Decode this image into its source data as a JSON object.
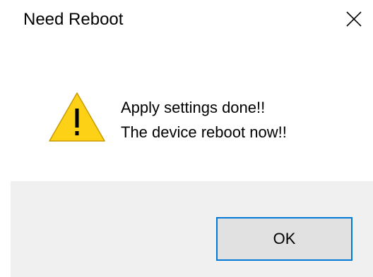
{
  "window": {
    "title": "Need Reboot",
    "close_icon": "close-icon"
  },
  "message": {
    "icon": "warning-icon",
    "line1": "Apply settings done!!",
    "line2": "The device reboot now!!"
  },
  "footer": {
    "ok_label": "OK"
  },
  "colors": {
    "footer_bg": "#f0f0f0",
    "button_border": "#0078d7",
    "button_bg": "#e1e1e1",
    "warning_fill": "#fcd116"
  }
}
